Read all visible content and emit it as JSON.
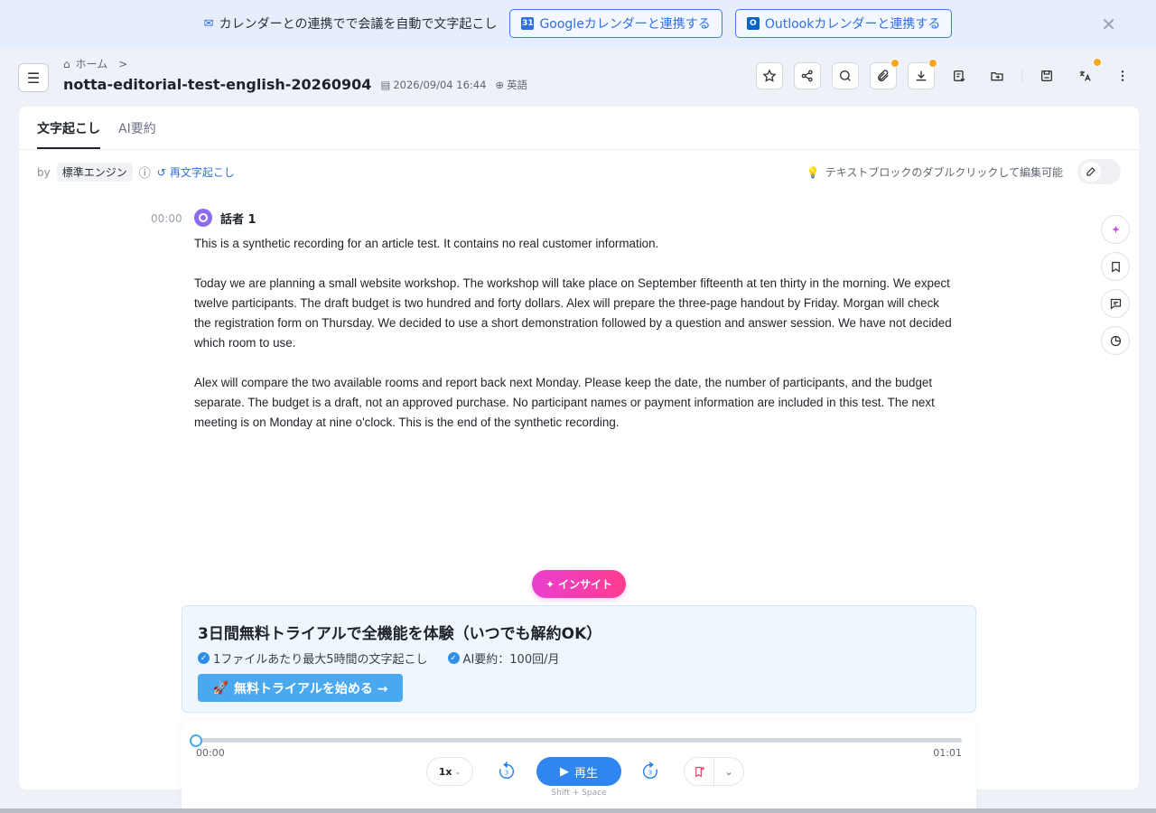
{
  "banner": {
    "text": "カレンダーとの連携でで会議を自動で文字起こし",
    "google_btn": "Googleカレンダーと連携する",
    "google_icon_text": "31",
    "outlook_btn": "Outlookカレンダーと連携する",
    "outlook_icon_text": "O"
  },
  "header": {
    "breadcrumb_home": "ホーム",
    "breadcrumb_sep": ">",
    "title": "notta-editorial-test-english-20260904",
    "datetime": "2026/09/04 16:44",
    "language": "英語"
  },
  "tabs": [
    {
      "label": "文字起こし"
    },
    {
      "label": "AI要約"
    }
  ],
  "engine": {
    "by": "by",
    "name": "標準エンジン",
    "retranscribe": "再文字起こし",
    "hint": "テキストブロックのダブルクリックして編集可能"
  },
  "transcript": {
    "timestamp": "00:00",
    "speaker": "話者 1",
    "paragraphs": [
      "This is a synthetic recording for an article test. It contains no real customer information.",
      "Today we are planning a small website workshop. The workshop will take place on September fifteenth at ten thirty in the morning. We expect twelve participants. The draft budget is two hundred and forty dollars. Alex will prepare the three-page handout by Friday. Morgan will check the registration form on Thursday. We decided to use a short demonstration followed by a question and answer session. We have not decided which room to use.",
      "Alex will compare the two available rooms and report back next Monday. Please keep the date, the number of participants, and the budget separate. The budget is a draft, not an approved purchase. No participant names or payment information are included in this test. The next meeting is on Monday at nine o'clock. This is the end of the synthetic recording."
    ]
  },
  "insight": {
    "label": "インサイト"
  },
  "trial": {
    "title": "3日間無料トライアルで全機能を体験（いつでも解約OK）",
    "features": [
      "1ファイルあたり最大5時間の文字起こし",
      "AI要約：100回/月"
    ],
    "cta": "無料トライアルを始める →"
  },
  "player": {
    "current_time": "00:00",
    "total_time": "01:01",
    "progress": 0,
    "speed": "1x",
    "skip_seconds": "3",
    "play_label": "再生",
    "shortcut": "Shift + Space"
  },
  "colors": {
    "accent": "#2f86f0",
    "insight_gradient_start": "#e93fd0",
    "insight_gradient_end": "#ff3d8f",
    "badge": "#f5a623"
  }
}
